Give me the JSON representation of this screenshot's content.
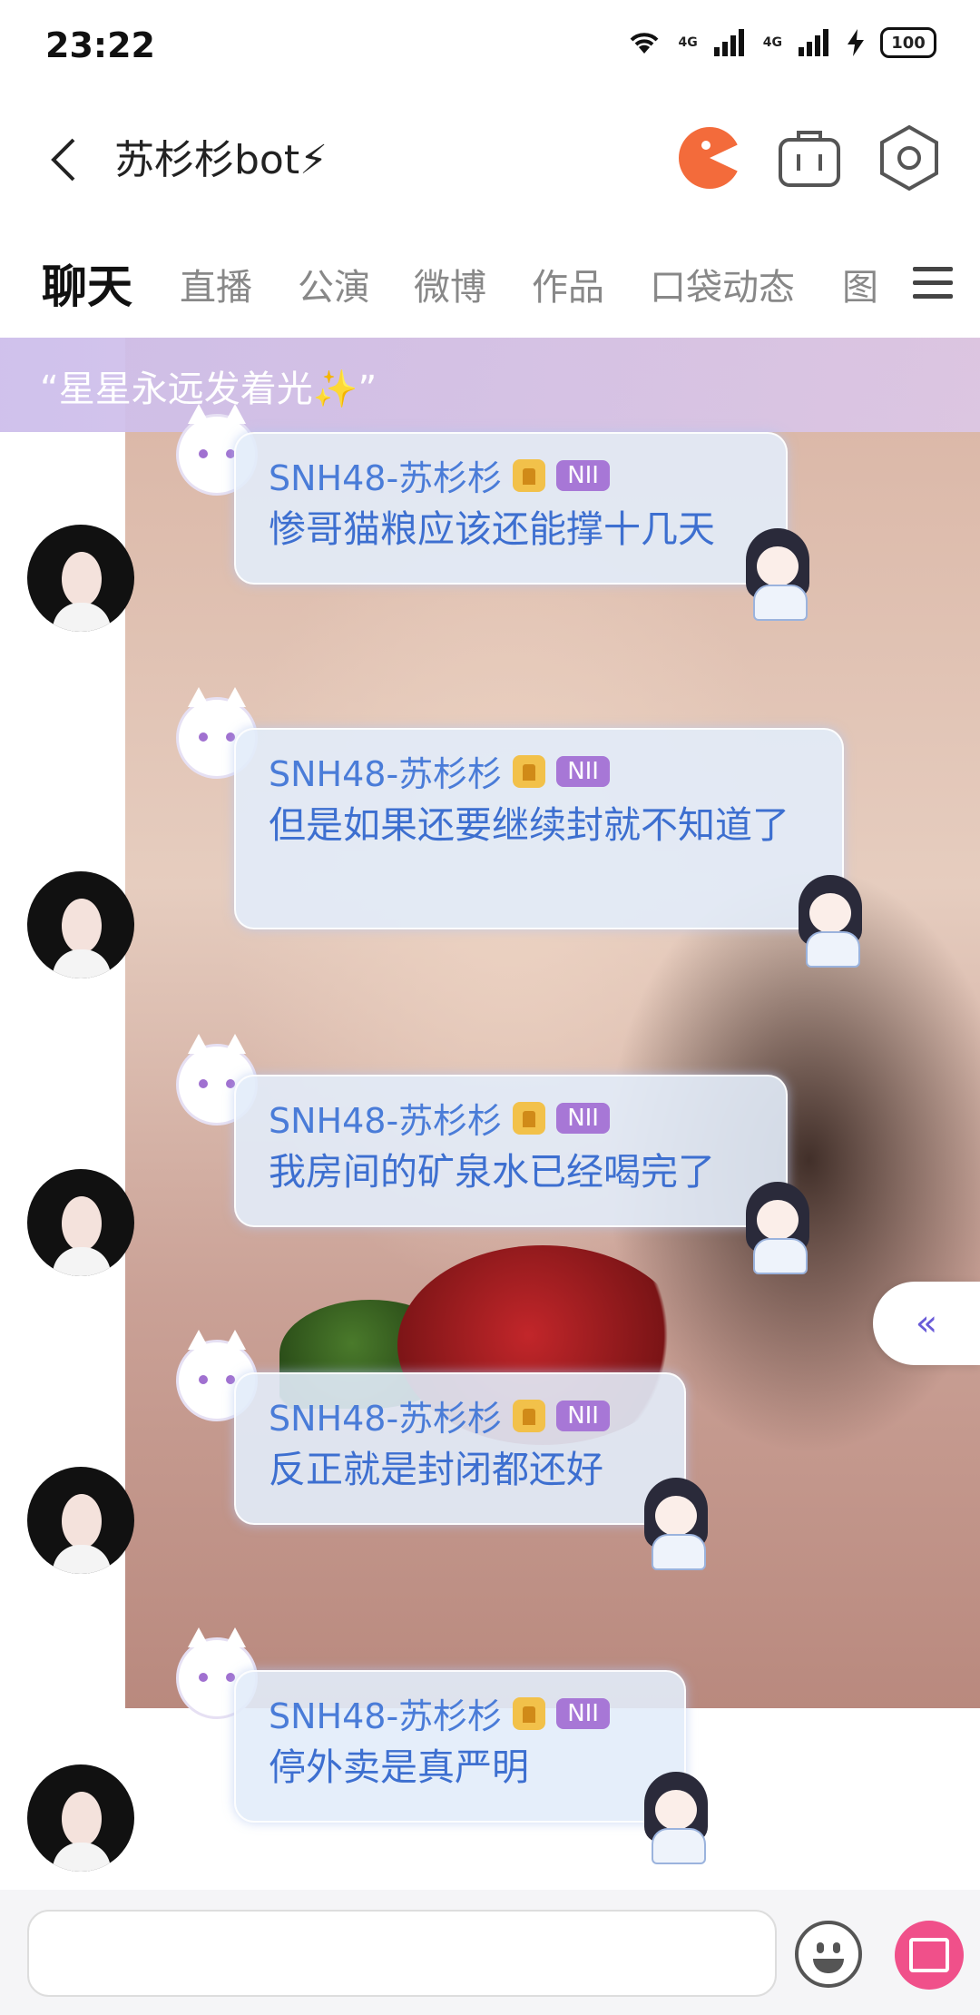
{
  "status_bar": {
    "time": "23:22",
    "net1": "4G",
    "net2": "4G",
    "battery": "100"
  },
  "header": {
    "title": "苏杉杉bot⚡"
  },
  "tabs": [
    {
      "label": "聊天",
      "active": true
    },
    {
      "label": "直播",
      "active": false
    },
    {
      "label": "公演",
      "active": false
    },
    {
      "label": "微博",
      "active": false
    },
    {
      "label": "作品",
      "active": false
    },
    {
      "label": "口袋动态",
      "active": false
    },
    {
      "label": "图",
      "active": false
    }
  ],
  "pinned": {
    "text": "“星星永远发着光✨”"
  },
  "messages": [
    {
      "sender": "SNH48-苏杉杉",
      "team": "NII",
      "text": "惨哥猫粮应该还能撑十几天"
    },
    {
      "sender": "SNH48-苏杉杉",
      "team": "NII",
      "text": "但是如果还要继续封就不知道了"
    },
    {
      "sender": "SNH48-苏杉杉",
      "team": "NII",
      "text": "我房间的矿泉水已经喝完了"
    },
    {
      "sender": "SNH48-苏杉杉",
      "team": "NII",
      "text": "反正就是封闭都还好"
    },
    {
      "sender": "SNH48-苏杉杉",
      "team": "NII",
      "text": "停外卖是真严明"
    }
  ],
  "side_tab": {
    "label": "«"
  },
  "input": {
    "placeholder": ""
  },
  "colors": {
    "accent_text": "#3d6fd0",
    "team_badge": "#a777d6",
    "gift_button": "#f0508a",
    "pinned_bg": "#cdbeeb"
  }
}
